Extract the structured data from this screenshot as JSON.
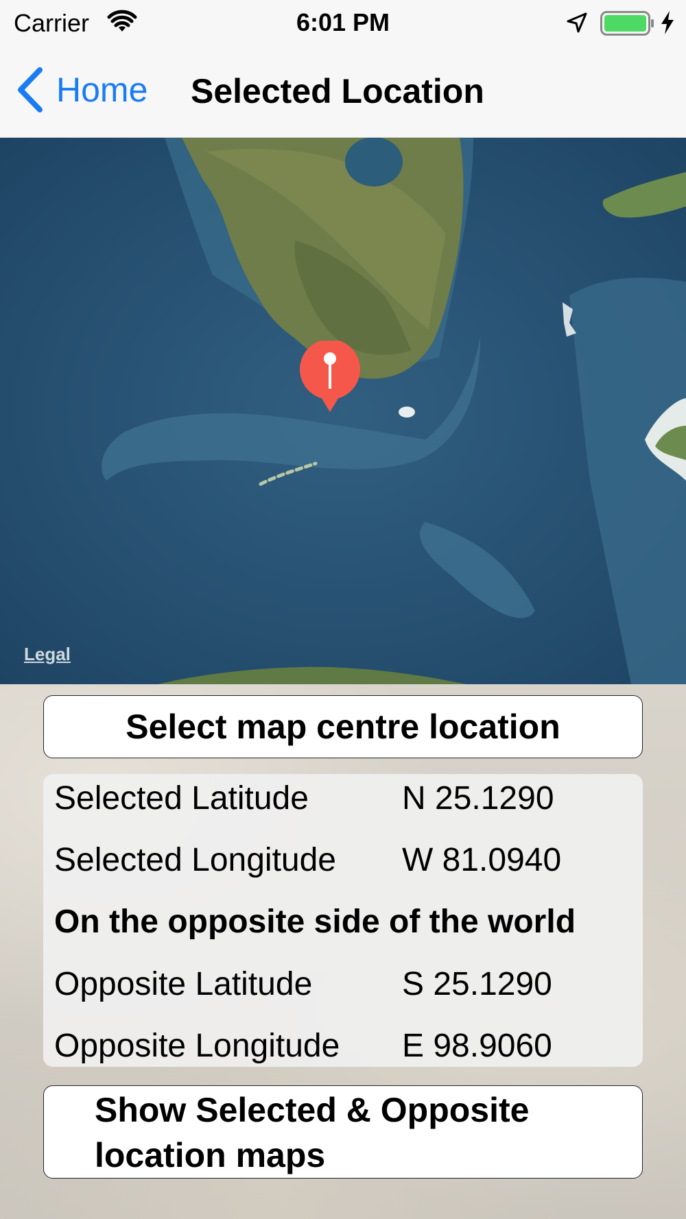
{
  "status_bar": {
    "carrier": "Carrier",
    "time": "6:01 PM",
    "battery_color": "#4cd964"
  },
  "nav": {
    "back_label": "Home",
    "title": "Selected Location",
    "tint": "#1a7cf5"
  },
  "map": {
    "legal": "Legal",
    "pin_color": "#f5584a"
  },
  "buttons": {
    "select_centre": "Select map centre location",
    "show_maps_line1": "Show Selected & Opposite",
    "show_maps_line2": "location maps"
  },
  "info": {
    "selected_latitude_label": "Selected Latitude",
    "selected_latitude_value": "N 25.1290",
    "selected_longitude_label": "Selected Longitude",
    "selected_longitude_value": "W 81.0940",
    "opposite_heading": "On the opposite side of the world",
    "opposite_latitude_label": "Opposite Latitude",
    "opposite_latitude_value": "S 25.1290",
    "opposite_longitude_label": "Opposite Longitude",
    "opposite_longitude_value": "E 98.9060"
  }
}
